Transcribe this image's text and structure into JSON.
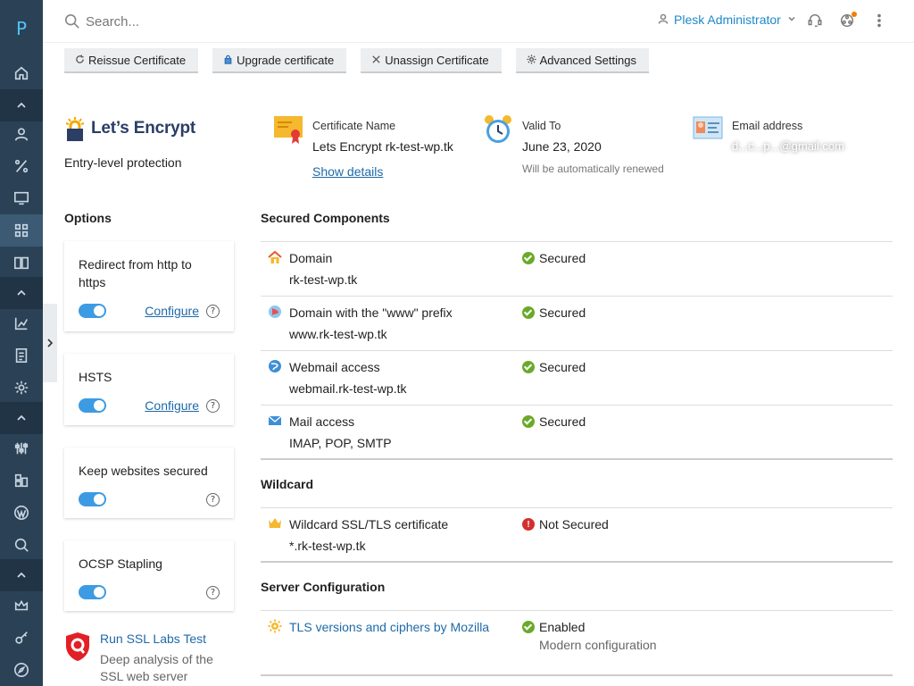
{
  "sidebar": {
    "logo_letter": "P"
  },
  "topbar": {
    "search_placeholder": "Search...",
    "user_name": "Plesk Administrator"
  },
  "toolbar": {
    "reissue": "Reissue Certificate",
    "upgrade": "Upgrade certificate",
    "unassign": "Unassign Certificate",
    "advanced": "Advanced Settings"
  },
  "brand": {
    "name": "Let’s Encrypt",
    "subtitle": "Entry-level protection"
  },
  "certificate": {
    "name_label": "Certificate Name",
    "name_value": "Lets Encrypt rk-test-wp.tk",
    "show_details": "Show details",
    "valid_label": "Valid To",
    "valid_value": "June 23, 2020",
    "valid_note": "Will be automatically renewed",
    "email_label": "Email address",
    "email_value": "d...c...p...@gmail.com"
  },
  "options": {
    "title": "Options",
    "items": [
      {
        "label": "Redirect from http to https",
        "configure": "Configure",
        "enabled": true
      },
      {
        "label": "HSTS",
        "configure": "Configure",
        "enabled": true
      },
      {
        "label": "Keep websites secured",
        "enabled": true
      },
      {
        "label": "OCSP Stapling",
        "enabled": true
      }
    ],
    "help_glyph": "?"
  },
  "ssl_labs": {
    "title": "Run SSL Labs Test",
    "description": "Deep analysis of the SSL web server"
  },
  "secured_components": {
    "title": "Secured Components",
    "rows": [
      {
        "name": "Domain",
        "sub": "rk-test-wp.tk",
        "status": "Secured",
        "icon": "house-icon"
      },
      {
        "name": "Domain with the \"www\" prefix",
        "sub": "www.rk-test-wp.tk",
        "status": "Secured",
        "icon": "www-globe-icon"
      },
      {
        "name": "Webmail access",
        "sub": "webmail.rk-test-wp.tk",
        "status": "Secured",
        "icon": "webmail-globe-icon"
      },
      {
        "name": "Mail access",
        "sub": "IMAP, POP, SMTP",
        "status": "Secured",
        "icon": "envelope-icon"
      }
    ]
  },
  "wildcard": {
    "title": "Wildcard",
    "rows": [
      {
        "name": "Wildcard SSL/TLS certificate",
        "sub": "*.rk-test-wp.tk",
        "status": "Not Secured",
        "status_glyph": "!",
        "icon": "crown-icon"
      }
    ]
  },
  "server_config": {
    "title": "Server Configuration",
    "rows": [
      {
        "name": "TLS versions and ciphers by Mozilla",
        "status": "Enabled",
        "status_sub": "Modern configuration",
        "icon": "gear-sun-icon"
      }
    ]
  },
  "colors": {
    "sidebar": "#2b4256",
    "accent": "#1e88c9",
    "ok": "#6aaa2a",
    "error": "#d32f2f",
    "toggle": "#3d9be3"
  }
}
